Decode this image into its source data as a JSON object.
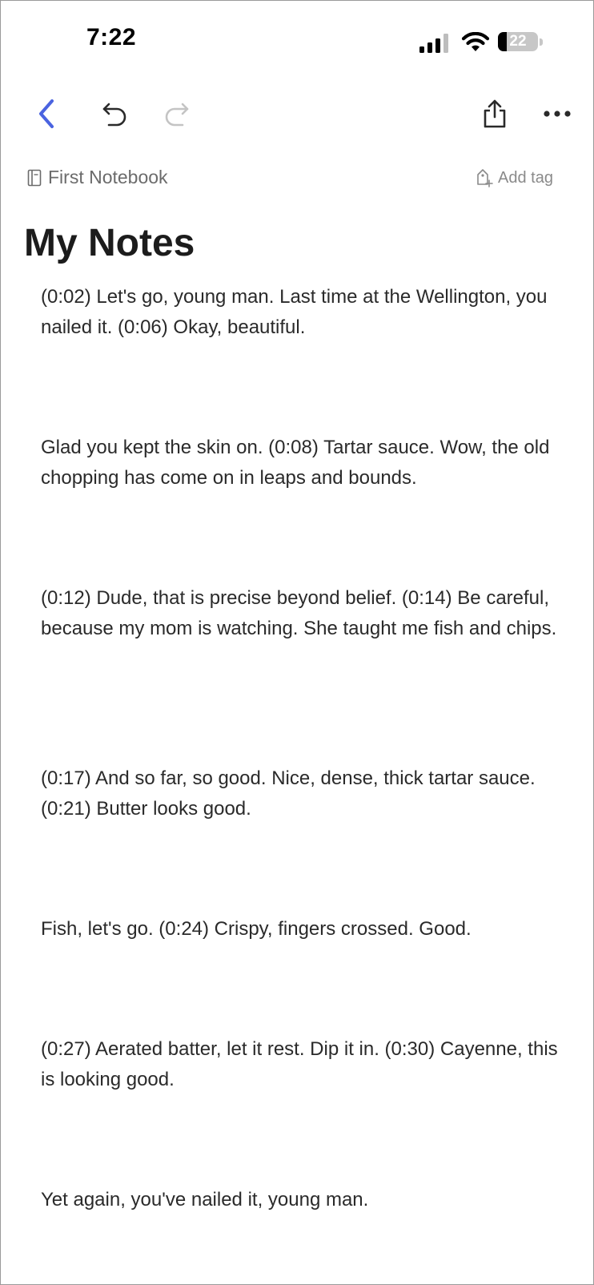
{
  "status_bar": {
    "time": "7:22",
    "battery_level": "22",
    "battery_fraction": 0.22
  },
  "toolbar": {
    "back_icon": "chevron-left-icon",
    "undo_icon": "undo-icon",
    "redo_icon": "redo-icon",
    "share_icon": "share-icon",
    "more_icon": "more-horizontal-icon",
    "accent_color": "#4a63e0"
  },
  "meta": {
    "notebook_name": "First Notebook",
    "add_tag_label": "Add tag"
  },
  "note": {
    "title": "My Notes",
    "paragraphs": [
      "(0:02) Let's go, young man. Last time at the Wellington, you nailed it. (0:06) Okay, beautiful.",
      "Glad you kept the skin on. (0:08) Tartar sauce. Wow, the old chopping has come on in leaps and bounds.",
      "(0:12) Dude, that is precise beyond belief. (0:14) Be careful, because my mom is watching. She taught me fish and chips.",
      "(0:17) And so far, so good. Nice, dense, thick tartar sauce. (0:21) Butter looks good.",
      "Fish, let's go. (0:24) Crispy, fingers crossed. Good.",
      "(0:27) Aerated batter, let it rest. Dip it in. (0:30) Cayenne, this is looking good.",
      "Yet again, you've nailed it, young man."
    ]
  }
}
